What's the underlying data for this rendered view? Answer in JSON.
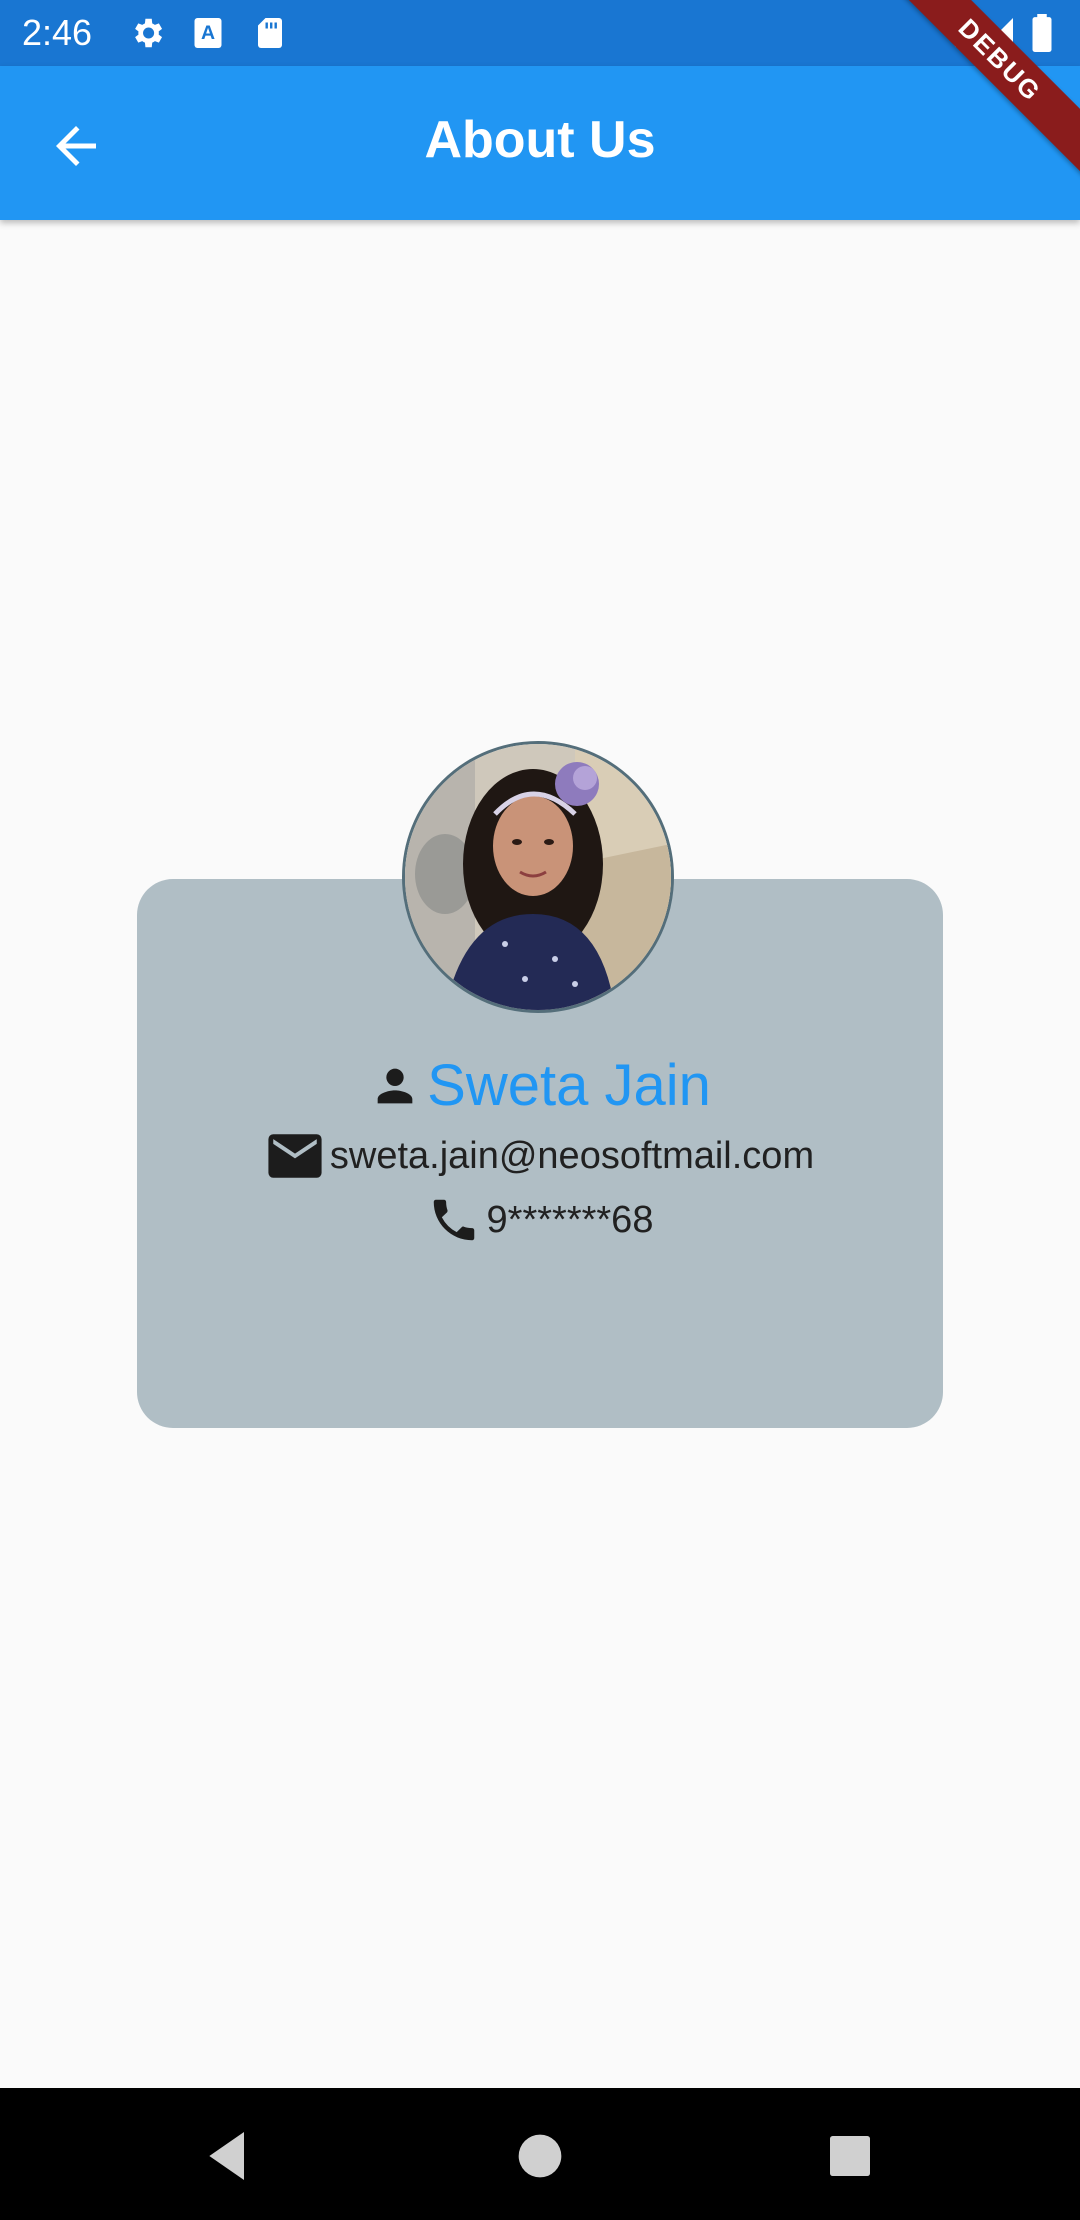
{
  "status_bar": {
    "time": "2:46",
    "icons": [
      "gear-icon",
      "keyboard-a-icon",
      "sd-card-icon",
      "wifi-icon",
      "signal-icon",
      "battery-icon"
    ]
  },
  "app_bar": {
    "title": "About Us",
    "back_icon": "arrow-back-icon"
  },
  "debug_banner": "DEBUG",
  "profile": {
    "name": "Sweta Jain",
    "email": "sweta.jain@neosoftmail.com",
    "phone": "9*******68"
  },
  "nav_bar": {
    "buttons": [
      "back-triangle-icon",
      "home-circle-icon",
      "recents-square-icon"
    ]
  },
  "colors": {
    "status_bar": "#1976d2",
    "app_bar": "#2196f3",
    "card": "#b0bec5",
    "name": "#2196f3",
    "background": "#fafafa",
    "debug_ribbon": "#8a1c1c"
  }
}
